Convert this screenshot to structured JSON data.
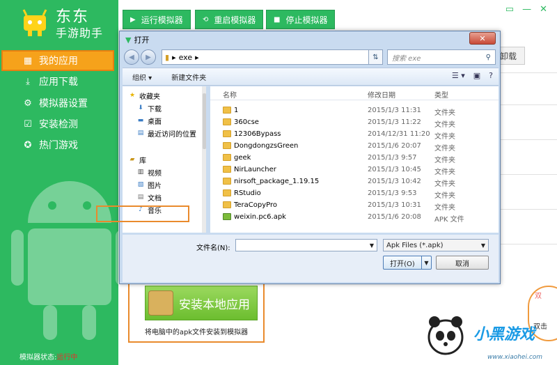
{
  "app": {
    "title_line1": "东东",
    "title_line2": "手游助手",
    "logo_icon": "android-robot-icon"
  },
  "sidebar": {
    "items": [
      {
        "label": "我的应用",
        "icon": "grid-icon",
        "glyph": "▦",
        "active": true
      },
      {
        "label": "应用下载",
        "icon": "download-icon",
        "glyph": "⤓"
      },
      {
        "label": "模拟器设置",
        "icon": "gear-icon",
        "glyph": "⚙"
      },
      {
        "label": "安装检测",
        "icon": "check-icon",
        "glyph": "☑"
      },
      {
        "label": "热门游戏",
        "icon": "hot-icon",
        "glyph": "✪"
      }
    ],
    "status_label": "模拟器状态:",
    "status_value": "运行中"
  },
  "toolbar": {
    "run_label": "运行模拟器",
    "restart_label": "重启模拟器",
    "stop_label": "停止模拟器"
  },
  "background": {
    "uninstall_label": "卸载"
  },
  "install": {
    "button_label": "安装本地应用",
    "hint": "将电脑中的apk文件安装到模拟器"
  },
  "watermark": {
    "text": "小黑游戏",
    "site": "www.xiaohei.com",
    "bubble_top": "双",
    "bubble_bottom": "双击"
  },
  "dialog": {
    "title": "打开",
    "close_label": "✕",
    "address": {
      "sep": "▸",
      "folder": "exe",
      "end": "▸"
    },
    "search_placeholder": "搜索 exe",
    "organize_label": "组织 ▾",
    "new_folder_label": "新建文件夹",
    "tree": {
      "favorites": "收藏夹",
      "download": "下载",
      "desktop": "桌面",
      "recent": "最近访问的位置",
      "library": "库",
      "video": "视频",
      "pictures": "图片",
      "docs": "文档",
      "music": "音乐"
    },
    "columns": {
      "name": "名称",
      "date": "修改日期",
      "type": "类型"
    },
    "files": [
      {
        "name": "1",
        "date": "2015/1/3 11:31",
        "type": "文件夹"
      },
      {
        "name": "360cse",
        "date": "2015/1/3 11:22",
        "type": "文件夹"
      },
      {
        "name": "12306Bypass",
        "date": "2014/12/31 11:20",
        "type": "文件夹"
      },
      {
        "name": "DongdongzsGreen",
        "date": "2015/1/6 20:07",
        "type": "文件夹"
      },
      {
        "name": "geek",
        "date": "2015/1/3 9:57",
        "type": "文件夹"
      },
      {
        "name": "NirLauncher",
        "date": "2015/1/3 10:45",
        "type": "文件夹"
      },
      {
        "name": "nirsoft_package_1.19.15",
        "date": "2015/1/3 10:42",
        "type": "文件夹"
      },
      {
        "name": "RStudio",
        "date": "2015/1/3 9:53",
        "type": "文件夹"
      },
      {
        "name": "TeraCopyPro",
        "date": "2015/1/3 10:31",
        "type": "文件夹"
      },
      {
        "name": "weixin.pc6.apk",
        "date": "2015/1/6 20:08",
        "type": "APK 文件"
      }
    ],
    "filename_label": "文件名(N):",
    "filename_value": "",
    "filetype_value": "Apk Files (*.apk)",
    "open_label": "打开(O)",
    "cancel_label": "取消"
  }
}
